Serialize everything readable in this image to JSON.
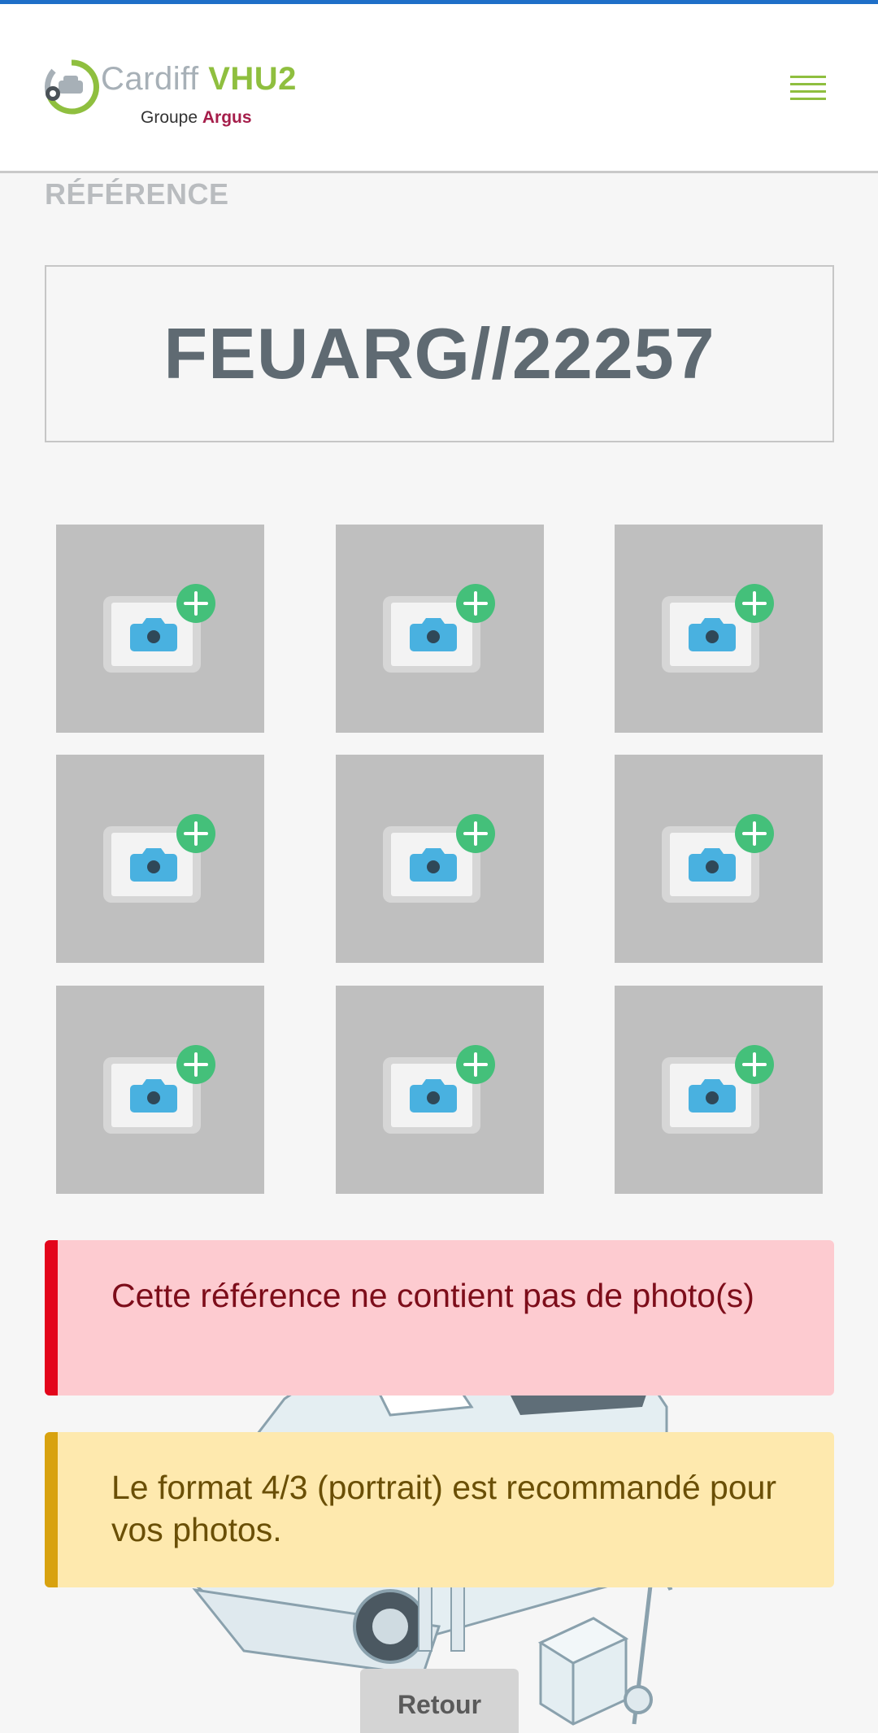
{
  "header": {
    "logo": {
      "brand_light": "Cardiff ",
      "brand_bold": "VHU2",
      "sub_light": "Groupe ",
      "sub_bold": "Argus"
    },
    "menu_icon": "hamburger-menu-icon",
    "accent_color": "#8fbf3f"
  },
  "reference": {
    "label": "RÉFÉRENCE",
    "value": "FEUARG//22257"
  },
  "photo_grid": {
    "tile_icon": "camera-add-icon",
    "tile_count": 9,
    "tiles": [
      {
        "state": "empty"
      },
      {
        "state": "empty"
      },
      {
        "state": "empty"
      },
      {
        "state": "empty"
      },
      {
        "state": "empty"
      },
      {
        "state": "empty"
      },
      {
        "state": "empty"
      },
      {
        "state": "empty"
      },
      {
        "state": "empty"
      }
    ]
  },
  "alerts": {
    "error": {
      "text": "Cette référence ne contient pas de photo(s)",
      "color": "#e3051b"
    },
    "warning": {
      "text": "Le format 4/3 (portrait) est recommandé pour vos photos.",
      "color": "#d8a20f"
    }
  },
  "footer": {
    "back_label": "Retour"
  }
}
